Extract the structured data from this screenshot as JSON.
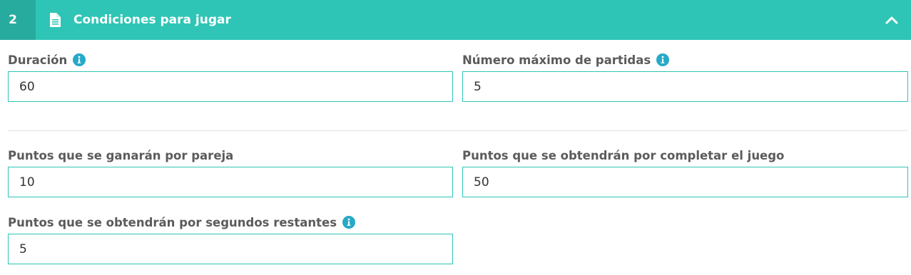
{
  "header": {
    "step_number": "2",
    "title": "Condiciones para jugar"
  },
  "fields": {
    "duracion": {
      "label": "Duración",
      "value": "60"
    },
    "max_partidas": {
      "label": "Número máximo de partidas",
      "value": "5"
    },
    "puntos_pareja": {
      "label": "Puntos que se ganarán por pareja",
      "value": "10"
    },
    "puntos_completar": {
      "label": "Puntos que se obtendrán por completar el juego",
      "value": "50"
    },
    "puntos_segundos": {
      "label": "Puntos que se obtendrán por segundos restantes",
      "value": "5"
    }
  },
  "icons": {
    "header": "document-icon",
    "collapse": "chevron-up-icon",
    "info": "info-icon"
  },
  "colors": {
    "accent": "#2ec5b6",
    "accent_dark": "#27ab9e",
    "info_icon": "#27a9c7",
    "label_text": "#5b5b5b",
    "divider": "#e3e3e3"
  }
}
